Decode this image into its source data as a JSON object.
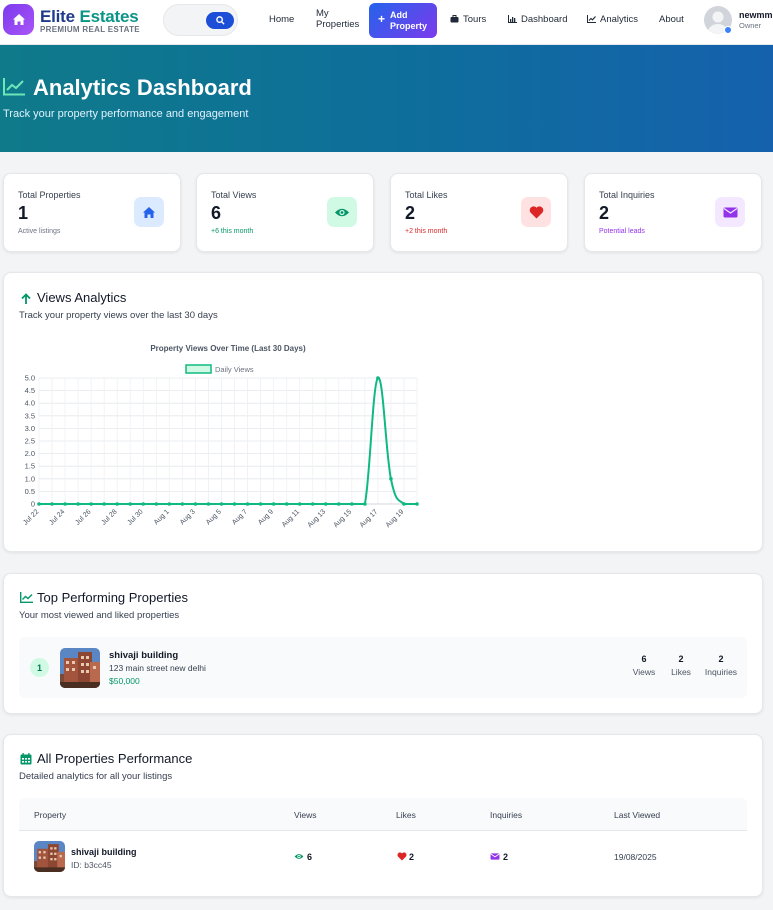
{
  "nav": {
    "brand_first": "Elite",
    "brand_second": "Estates",
    "brand_tagline": "PREMIUM REAL ESTATE",
    "search_placeholder": "",
    "home": "Home",
    "my_properties_line1": "My",
    "my_properties_line2": "Properties",
    "add_property_line1": "Add",
    "add_property_line2": "Property",
    "tours": "Tours",
    "dashboard": "Dashboard",
    "analytics": "Analytics",
    "about": "About",
    "user_name": "newmm",
    "user_role": "Owner"
  },
  "hero": {
    "title": "Analytics Dashboard",
    "subtitle": "Track your property performance and engagement"
  },
  "stats": [
    {
      "label": "Total Properties",
      "value": "1",
      "note": "Active listings",
      "icon": "home-icon",
      "color": "#2563eb",
      "bg": "#dbeafe",
      "note_color": "#6b7280"
    },
    {
      "label": "Total Views",
      "value": "6",
      "note": "+6 this month",
      "icon": "eye-icon",
      "color": "#059669",
      "bg": "#d1fae5",
      "note_color": "#059669"
    },
    {
      "label": "Total Likes",
      "value": "2",
      "note": "+2 this month",
      "icon": "heart-icon",
      "color": "#dc2626",
      "bg": "#fee2e2",
      "note_color": "#dc2626"
    },
    {
      "label": "Total Inquiries",
      "value": "2",
      "note": "Potential leads",
      "icon": "envelope-icon",
      "color": "#9333ea",
      "bg": "#f3e8ff",
      "note_color": "#9333ea"
    }
  ],
  "views_section": {
    "title": "Views Analytics",
    "subtitle": "Track your property views over the last 30 days"
  },
  "chart_data": {
    "type": "line",
    "title": "Property Views Over Time (Last 30 Days)",
    "legend_position": "top",
    "grid": true,
    "ylim": [
      0,
      5
    ],
    "yticks": [
      "0",
      "0.5",
      "1.0",
      "1.5",
      "2.0",
      "2.5",
      "3.0",
      "3.5",
      "4.0",
      "4.5",
      "5.0"
    ],
    "x": [
      "Jul 22",
      "Jul 23",
      "Jul 24",
      "Jul 25",
      "Jul 26",
      "Jul 27",
      "Jul 28",
      "Jul 29",
      "Jul 30",
      "Jul 31",
      "Aug 1",
      "Aug 2",
      "Aug 3",
      "Aug 4",
      "Aug 5",
      "Aug 6",
      "Aug 7",
      "Aug 8",
      "Aug 9",
      "Aug 10",
      "Aug 11",
      "Aug 12",
      "Aug 13",
      "Aug 14",
      "Aug 15",
      "Aug 16",
      "Aug 17",
      "Aug 18",
      "Aug 19",
      "Aug 20"
    ],
    "xtick_labels": [
      "Jul 22",
      "Jul 24",
      "Jul 26",
      "Jul 28",
      "Jul 30",
      "Aug 1",
      "Aug 3",
      "Aug 5",
      "Aug 7",
      "Aug 9",
      "Aug 11",
      "Aug 13",
      "Aug 15",
      "Aug 17",
      "Aug 19"
    ],
    "series": [
      {
        "name": "Daily Views",
        "color": "#10b981",
        "values": [
          0,
          0,
          0,
          0,
          0,
          0,
          0,
          0,
          0,
          0,
          0,
          0,
          0,
          0,
          0,
          0,
          0,
          0,
          0,
          0,
          0,
          0,
          0,
          0,
          0,
          0,
          5,
          1,
          0,
          0
        ]
      }
    ]
  },
  "top_section": {
    "title": "Top Performing Properties",
    "subtitle": "Your most viewed and liked properties",
    "items": [
      {
        "rank": "1",
        "name": "shivaji building",
        "address": "123 main street new delhi",
        "price": "$50,000",
        "views": "6",
        "views_label": "Views",
        "likes": "2",
        "likes_label": "Likes",
        "inquiries": "2",
        "inquiries_label": "Inquiries"
      }
    ]
  },
  "all_section": {
    "title": "All Properties Performance",
    "subtitle": "Detailed analytics for all your listings",
    "columns": [
      "Property",
      "Views",
      "Likes",
      "Inquiries",
      "Last Viewed"
    ],
    "rows": [
      {
        "name": "shivaji building",
        "id": "ID: b3cc45",
        "views": "6",
        "likes": "2",
        "inquiries": "2",
        "last_viewed": "19/08/2025"
      }
    ]
  }
}
